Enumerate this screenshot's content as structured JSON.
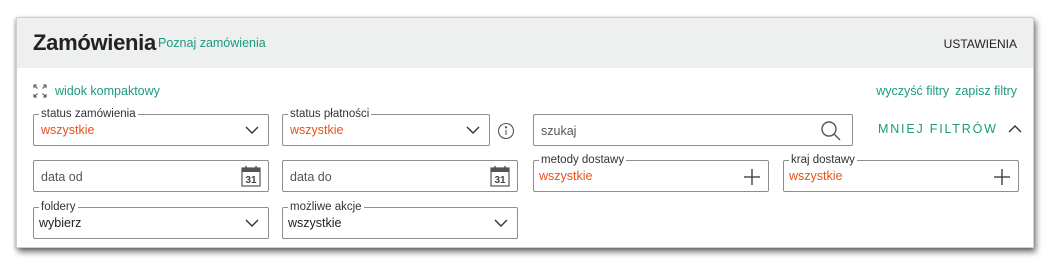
{
  "header": {
    "title": "Zamówienia",
    "title_link": "Poznaj zamówienia",
    "settings": "USTAWIENIA"
  },
  "toolbar": {
    "compact_view": "widok kompaktowy",
    "clear_filters": "wyczyść filtry",
    "save_filters": "zapisz filtry",
    "less_filters": "MNIEJ FILTRÓW"
  },
  "filters": {
    "order_status": {
      "label": "status zamówienia",
      "value": "wszystkie"
    },
    "payment_status": {
      "label": "status płatności",
      "value": "wszystkie"
    },
    "search": {
      "placeholder": "szukaj"
    },
    "date_from": {
      "placeholder": "data od",
      "calendar_day": "31"
    },
    "date_to": {
      "placeholder": "data do",
      "calendar_day": "31"
    },
    "shipping_methods": {
      "label": "metody dostawy",
      "value": "wszystkie"
    },
    "shipping_country": {
      "label": "kraj dostawy",
      "value": "wszystkie"
    },
    "folders": {
      "label": "foldery",
      "value": "wybierz"
    },
    "possible_actions": {
      "label": "możliwe akcje",
      "value": "wszystkie"
    }
  },
  "colors": {
    "accent": "#1c9a7c",
    "value_orange": "#e5541e",
    "header_bg": "#eeefef",
    "border": "#8d8d8d"
  }
}
